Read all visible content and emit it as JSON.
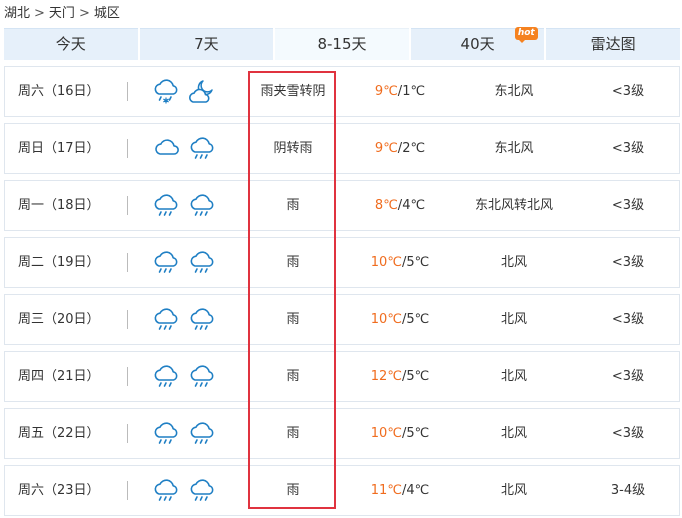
{
  "breadcrumb": {
    "province": "湖北",
    "city": "天门",
    "district": "城区",
    "separator": ">"
  },
  "tabs": [
    {
      "label": "今天",
      "active": false
    },
    {
      "label": "7天",
      "active": false
    },
    {
      "label": "8-15天",
      "active": true
    },
    {
      "label": "40天",
      "active": false,
      "badge": "hot"
    },
    {
      "label": "雷达图",
      "active": false
    }
  ],
  "colors": {
    "high_temp": "#f06c1e",
    "highlight_box": "#e0333f",
    "tab_bg": "#e6f0fa",
    "icon_blue": "#1f7fc4"
  },
  "days": [
    {
      "day": "周六（16日）",
      "icons": [
        "rain-snow-icon",
        "moon-cloud-icon"
      ],
      "condition": "雨夹雪转阴",
      "high": "9℃",
      "low": "1℃",
      "wind": "东北风",
      "level": "<3级"
    },
    {
      "day": "周日（17日）",
      "icons": [
        "cloudy-icon",
        "rain-icon"
      ],
      "condition": "阴转雨",
      "high": "9℃",
      "low": "2℃",
      "wind": "东北风",
      "level": "<3级"
    },
    {
      "day": "周一（18日）",
      "icons": [
        "rain-icon",
        "rain-icon"
      ],
      "condition": "雨",
      "high": "8℃",
      "low": "4℃",
      "wind": "东北风转北风",
      "level": "<3级"
    },
    {
      "day": "周二（19日）",
      "icons": [
        "rain-icon",
        "rain-icon"
      ],
      "condition": "雨",
      "high": "10℃",
      "low": "5℃",
      "wind": "北风",
      "level": "<3级"
    },
    {
      "day": "周三（20日）",
      "icons": [
        "rain-icon",
        "rain-icon"
      ],
      "condition": "雨",
      "high": "10℃",
      "low": "5℃",
      "wind": "北风",
      "level": "<3级"
    },
    {
      "day": "周四（21日）",
      "icons": [
        "rain-icon",
        "rain-icon"
      ],
      "condition": "雨",
      "high": "12℃",
      "low": "5℃",
      "wind": "北风",
      "level": "<3级"
    },
    {
      "day": "周五（22日）",
      "icons": [
        "rain-icon",
        "rain-icon"
      ],
      "condition": "雨",
      "high": "10℃",
      "low": "5℃",
      "wind": "北风",
      "level": "<3级"
    },
    {
      "day": "周六（23日）",
      "icons": [
        "rain-icon",
        "rain-icon"
      ],
      "condition": "雨",
      "high": "11℃",
      "low": "4℃",
      "wind": "北风",
      "level": "3-4级"
    }
  ]
}
